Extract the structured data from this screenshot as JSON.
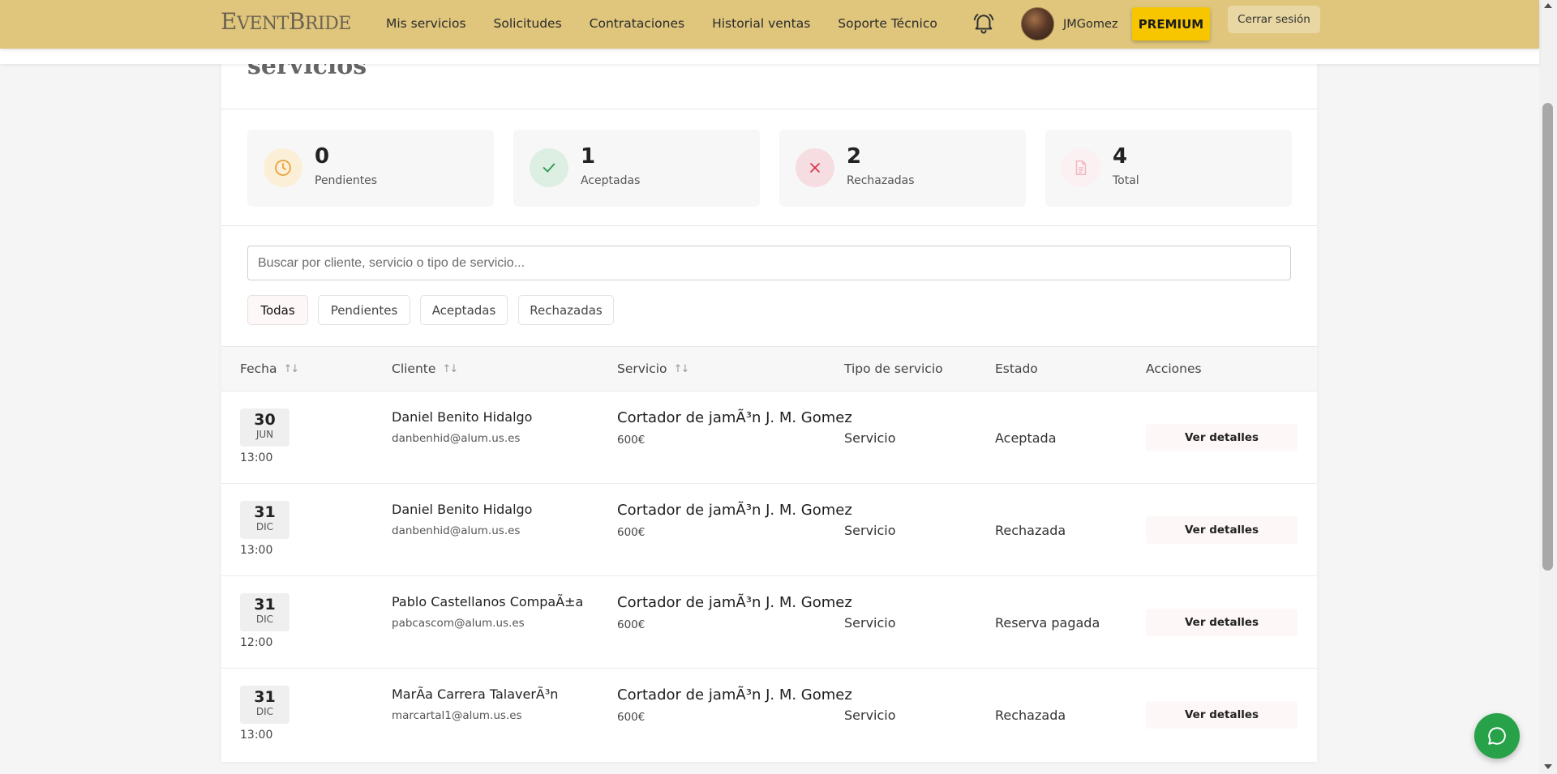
{
  "navbar": {
    "brand": "EventBride",
    "links": [
      "Mis servicios",
      "Solicitudes",
      "Contrataciones",
      "Historial ventas",
      "Soporte Técnico"
    ],
    "username": "JMGomez",
    "premium_label": "PREMIUM",
    "logout_label": "Cerrar sesión"
  },
  "page": {
    "title": "servicios"
  },
  "stats": [
    {
      "value": "0",
      "label": "Pendientes",
      "icon": "clock-icon",
      "color": "#e9a23b",
      "bg": "#fbefd8"
    },
    {
      "value": "1",
      "label": "Aceptadas",
      "icon": "check-icon",
      "color": "#2e9a55",
      "bg": "#dcefe2"
    },
    {
      "value": "2",
      "label": "Rechazadas",
      "icon": "x-icon",
      "color": "#d9344a",
      "bg": "#f6dde1"
    },
    {
      "value": "4",
      "label": "Total",
      "icon": "document-icon",
      "color": "#f0b8c2",
      "bg": "#fbf0f2"
    }
  ],
  "search": {
    "placeholder": "Buscar por cliente, servicio o tipo de servicio..."
  },
  "filters": [
    "Todas",
    "Pendientes",
    "Aceptadas",
    "Rechazadas"
  ],
  "active_filter": "Todas",
  "table": {
    "headers": [
      "Fecha",
      "Cliente",
      "Servicio",
      "Tipo de servicio",
      "Estado",
      "Acciones"
    ],
    "rows": [
      {
        "day": "30",
        "month": "JUN",
        "time": "13:00",
        "client": "Daniel Benito Hidalgo",
        "email": "danbenhid@alum.us.es",
        "service": "Cortador de jamÃ³n J. M. Gomez",
        "price": "600€",
        "type": "Servicio",
        "status": "Aceptada",
        "action": "Ver detalles"
      },
      {
        "day": "31",
        "month": "DIC",
        "time": "13:00",
        "client": "Daniel Benito Hidalgo",
        "email": "danbenhid@alum.us.es",
        "service": "Cortador de jamÃ³n J. M. Gomez",
        "price": "600€",
        "type": "Servicio",
        "status": "Rechazada",
        "action": "Ver detalles"
      },
      {
        "day": "31",
        "month": "DIC",
        "time": "12:00",
        "client": "Pablo Castellanos CompaÃ±a",
        "email": "pabcascom@alum.us.es",
        "service": "Cortador de jamÃ³n J. M. Gomez",
        "price": "600€",
        "type": "Servicio",
        "status": "Reserva pagada",
        "action": "Ver detalles"
      },
      {
        "day": "31",
        "month": "DIC",
        "time": "13:00",
        "client": "MarÃa Carrera TalaverÃ³n",
        "email": "marcartal1@alum.us.es",
        "service": "Cortador de jamÃ³n J. M. Gomez",
        "price": "600€",
        "type": "Servicio",
        "status": "Rechazada",
        "action": "Ver detalles"
      }
    ]
  },
  "colors": {
    "navbar": "#dfc67c",
    "premium": "#f7c600",
    "chat": "#27a249"
  }
}
